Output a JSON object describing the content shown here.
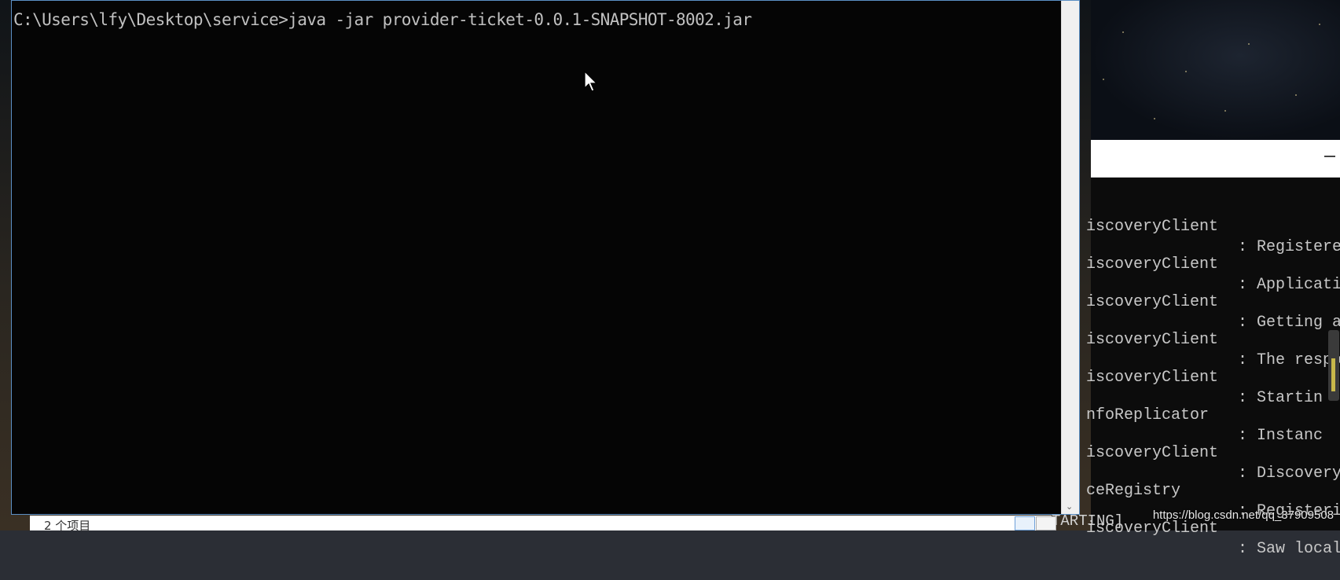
{
  "cmd_window": {
    "command_line": "C:\\Users\\lfy\\Desktop\\service>java -jar provider-ticket-0.0.1-SNAPSHOT-8002.jar"
  },
  "background_console": {
    "lines": [
      {
        "source": "iscoveryClient",
        "message": ": Registere"
      },
      {
        "source": "iscoveryClient",
        "message": ": Applicati"
      },
      {
        "source": "iscoveryClient",
        "message": ": Getting a"
      },
      {
        "source": "iscoveryClient",
        "message": ": The respo"
      },
      {
        "source": "iscoveryClient",
        "message": ": Startin"
      },
      {
        "source": "nfoReplicator",
        "message": ": Instanc"
      },
      {
        "source": "iscoveryClient",
        "message": ": Discovery"
      },
      {
        "source": "ceRegistry",
        "message": ": Registeri"
      },
      {
        "source": "iscoveryClient",
        "message": ": Saw local"
      }
    ],
    "status": "TARTING]"
  },
  "explorer": {
    "item_count": "2 个项目"
  },
  "watermark": "https://blog.csdn.net/qq_37909508",
  "icons": {
    "cursor": "mouse-pointer-icon",
    "scroll_down": "chevron-down-icon",
    "details_view": "details-view-icon",
    "large_icons_view": "large-icons-view-icon",
    "minimize": "minimize-icon"
  },
  "colors": {
    "cmd_background": "#050505",
    "cmd_text": "#c0c0c0",
    "window_border": "#5b8fc4"
  }
}
